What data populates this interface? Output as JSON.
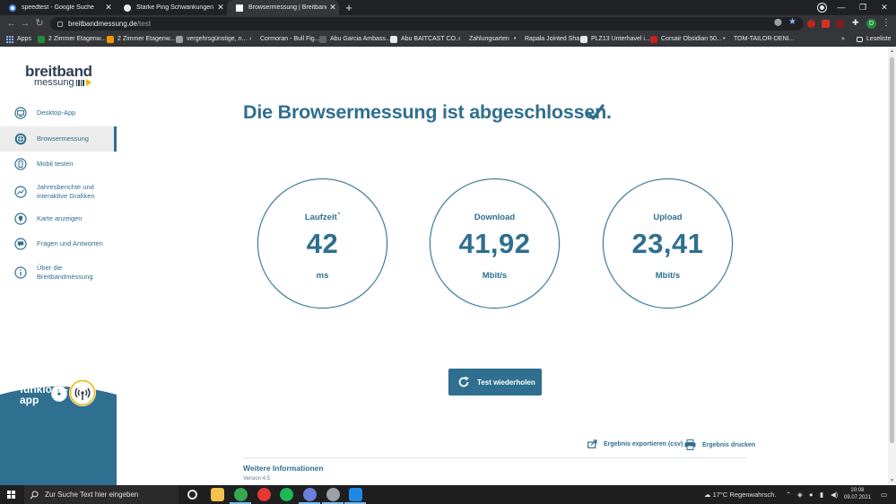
{
  "browser": {
    "tabs": [
      {
        "title": "speedtest - Google Suche",
        "active": false
      },
      {
        "title": "Starke Ping Schwankungen und",
        "active": false
      },
      {
        "title": "Browsermessung | Breitbandmes",
        "active": true
      }
    ],
    "url_host": "breitbandmessung.de",
    "url_path": "/test",
    "bookmarks": [
      "Apps",
      "2 Zimmer Etagenw...",
      "2 Zimmer Etagenw...",
      "vergehrsgünstige, n...",
      "Cormoran - Bull Fig...",
      "Abu Garcia Ambass...",
      "Abu BAITCAST CO...",
      "Zahlungsarten",
      "Rapala Jointed Sha...",
      "PLZ13 Unterhavel i...",
      "Corsair Obsidian 50...",
      "TOM-TAILOR-DENI..."
    ],
    "reading_list": "Leseliste",
    "avatar_letter": "D"
  },
  "logo": {
    "line1": "breitband",
    "line2": "messung"
  },
  "nav": [
    {
      "label": "Desktop-App",
      "icon": "desktop-icon",
      "active": false
    },
    {
      "label": "Browsermessung",
      "icon": "globe-icon",
      "active": true
    },
    {
      "label": "Mobil testen",
      "icon": "mobile-icon",
      "active": false
    },
    {
      "label": "Jahresberichte und",
      "label2": "interaktive Grafiken",
      "icon": "chart-icon",
      "active": false
    },
    {
      "label": "Karte anzeigen",
      "icon": "map-pin-icon",
      "active": false
    },
    {
      "label": "Fragen und Antworten",
      "icon": "chat-icon",
      "active": false
    },
    {
      "label": "Über die",
      "label2": "Breitbandmessung",
      "icon": "info-icon",
      "active": false
    }
  ],
  "funkloch": {
    "line1": "funkloch-",
    "line2": "app"
  },
  "headline": "Die Browsermessung ist abgeschlossen.",
  "results": [
    {
      "label": "Laufzeit",
      "sup": "*",
      "value": "42",
      "unit": "ms"
    },
    {
      "label": "Download",
      "sup": "",
      "value": "41,92",
      "unit": "Mbit/s"
    },
    {
      "label": "Upload",
      "sup": "",
      "value": "23,41",
      "unit": "Mbit/s"
    }
  ],
  "retest_label": "Test wiederholen",
  "export_label": "Ergebnis exportieren (csv)",
  "print_label": "Ergebnis drucken",
  "info_heading": "Weitere Informationen",
  "version": "Version 4.5",
  "taskbar": {
    "search_placeholder": "Zur Suche Text hier eingeben",
    "weather": "17°C  Regenwahrsch.",
    "time": "20:08",
    "date": "09.07.2021"
  },
  "colors": {
    "brand": "#2f6f8f",
    "funkloch_blue": "#2f6f8f",
    "chrome_dark": "#202124"
  }
}
